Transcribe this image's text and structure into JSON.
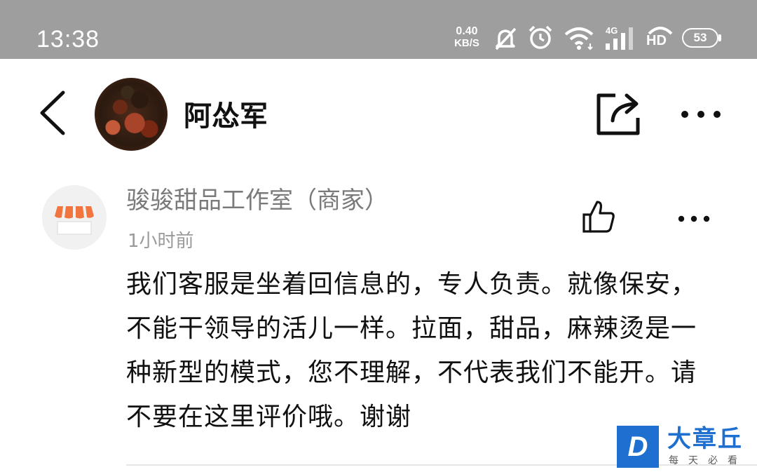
{
  "status_bar": {
    "time": "13:38",
    "net_speed_value": "0.40",
    "net_speed_unit": "KB/S",
    "signal_label": "4G",
    "hd_label": "HD",
    "battery": "53",
    "icons": [
      "mute-icon",
      "alarm-icon",
      "wifi-icon",
      "signal-icon",
      "hd-call-icon",
      "battery-icon"
    ]
  },
  "header": {
    "title": "阿怂军",
    "back_icon": "back-arrow-icon",
    "share_icon": "share-icon",
    "more_icon": "more-icon"
  },
  "comment": {
    "author": "骏骏甜品工作室（商家）",
    "time": "1小时前",
    "text": "我们客服是坐着回信息的，专人负责。就像保安，不能干领导的活儿一样。拉面，甜品，麻辣烫是一种新型的模式，您不理解，不代表我们不能开。请不要在这里评价哦。谢谢",
    "like_icon": "thumbs-up-icon",
    "more_icon": "more-icon"
  },
  "watermark": {
    "letter": "D",
    "title": "大章丘",
    "subtitle": "每天必看"
  },
  "colors": {
    "status_bar_bg": "#9e9e9e",
    "shop_awning": "#f2743e",
    "watermark_blue": "#1e6fd0"
  }
}
